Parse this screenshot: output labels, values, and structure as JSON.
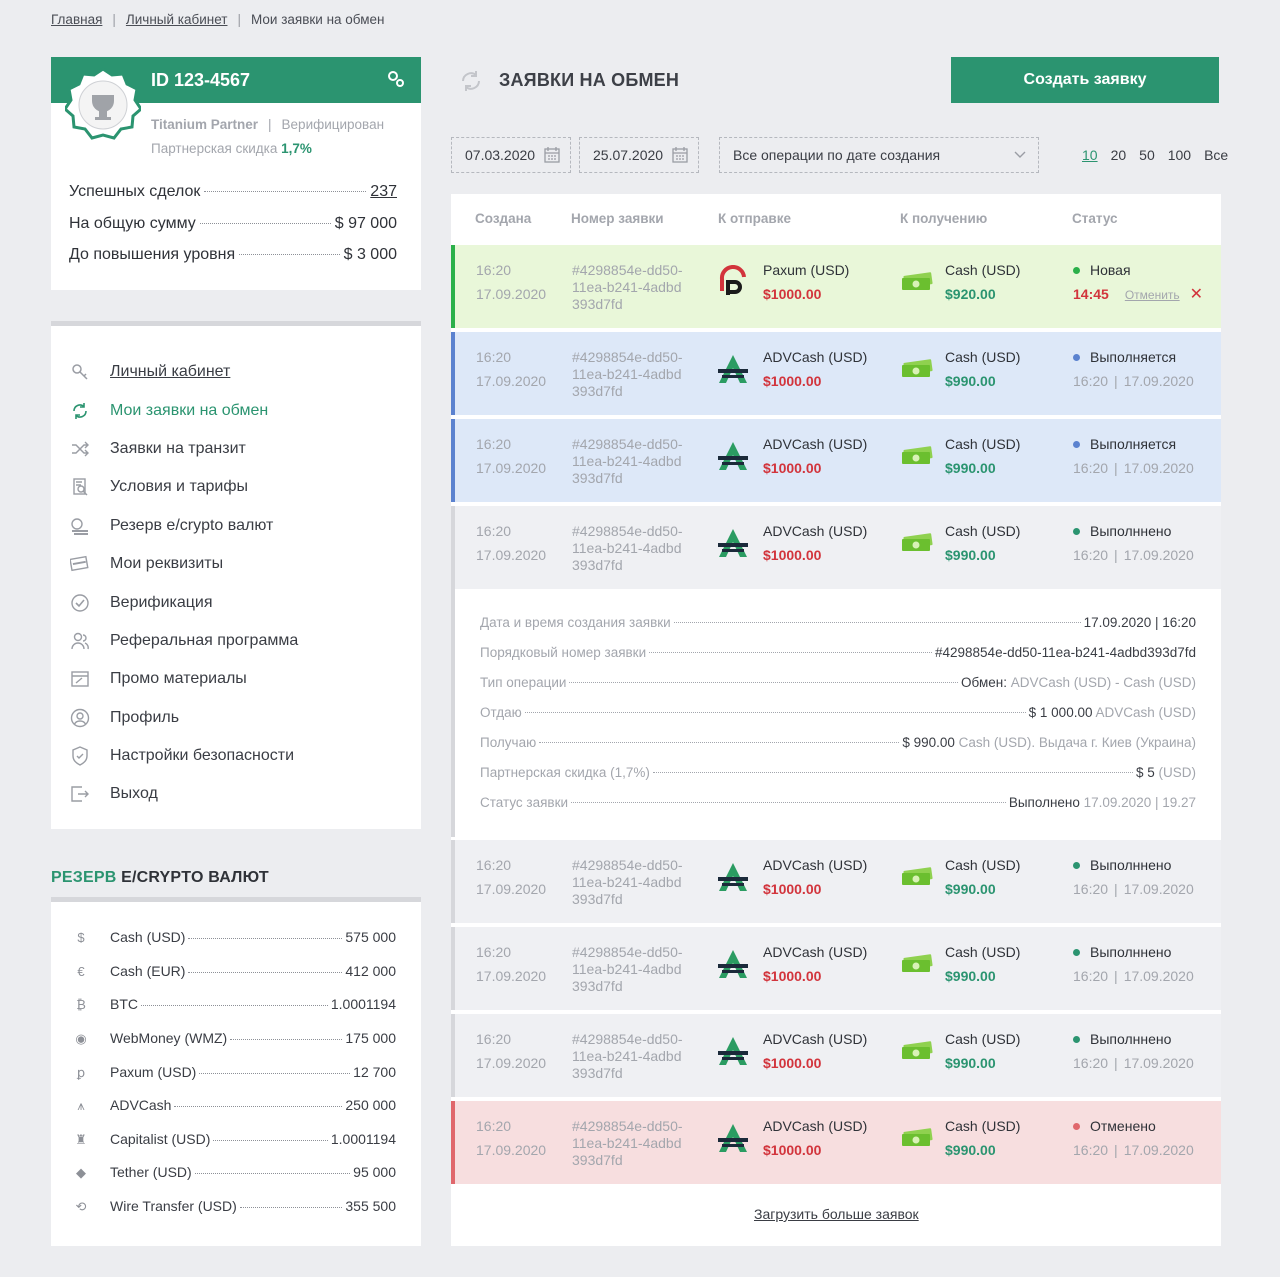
{
  "breadcrumb": {
    "items": [
      "Главная",
      "Личный кабинет",
      "Мои заявки на обмен"
    ]
  },
  "account": {
    "id": "ID 123-4567",
    "level": "Titanium Partner",
    "verified": "Верифицирован",
    "discount_label": "Партнерская скидка",
    "discount_value": "1,7%",
    "stats": [
      {
        "label": "Успешных сделок",
        "value": "237"
      },
      {
        "label": "На общую сумму",
        "value": "$ 97 000"
      },
      {
        "label": "До повышения уровня",
        "value": "$ 3 000"
      }
    ]
  },
  "sidebar": {
    "items": [
      {
        "label": "Личный кабинет",
        "icon": "key-icon"
      },
      {
        "label": "Мои заявки на обмен",
        "icon": "refresh-icon"
      },
      {
        "label": "Заявки на транзит",
        "icon": "shuffle-icon"
      },
      {
        "label": "Условия и тарифы",
        "icon": "document-search-icon"
      },
      {
        "label": "Резерв e/crypto валют",
        "icon": "coins-icon"
      },
      {
        "label": "Мои реквизиты",
        "icon": "card-icon"
      },
      {
        "label": "Верификация",
        "icon": "check-circle-icon"
      },
      {
        "label": "Реферальная программа",
        "icon": "users-icon"
      },
      {
        "label": "Промо материалы",
        "icon": "promo-icon"
      },
      {
        "label": "Профиль",
        "icon": "user-circle-icon"
      },
      {
        "label": "Настройки безопасности",
        "icon": "shield-icon"
      },
      {
        "label": "Выход",
        "icon": "logout-icon"
      }
    ]
  },
  "reserve": {
    "title_green": "РЕЗЕРВ",
    "title_rest": "E/CRYPTO ВАЛЮТ",
    "items": [
      {
        "name": "Cash (USD)",
        "value": "575 000",
        "icon": "$"
      },
      {
        "name": "Cash (EUR)",
        "value": "412 000",
        "icon": "€"
      },
      {
        "name": "BTC",
        "value": "1.0001194",
        "icon": "₿"
      },
      {
        "name": "WebMoney (WMZ)",
        "value": "175 000",
        "icon": "◉"
      },
      {
        "name": "Paxum (USD)",
        "value": "12 700",
        "icon": "ꝑ"
      },
      {
        "name": "ADVCash",
        "value": "250 000",
        "icon": "⩚"
      },
      {
        "name": "Capitalist (USD)",
        "value": "1.0001194",
        "icon": "♜"
      },
      {
        "name": "Tether (USD)",
        "value": "95 000",
        "icon": "◆"
      },
      {
        "name": "Wire Transfer (USD)",
        "value": "355 500",
        "icon": "⟲"
      }
    ]
  },
  "main": {
    "title": "ЗАЯВКИ НА ОБМЕН",
    "create_button": "Создать заявку",
    "date_from": "07.03.2020",
    "date_to": "25.07.2020",
    "filter": "Все операции по дате создания",
    "per_page": [
      "10",
      "20",
      "50",
      "100",
      "Все"
    ],
    "columns": [
      "Создана",
      "Номер заявки",
      "К отправке",
      "К получению",
      "Статус"
    ],
    "load_more": "Загрузить больше заявок"
  },
  "orders": [
    {
      "time": "16:20",
      "date": "17.09.2020",
      "id1": "#4298854e-dd50-",
      "id2": "11ea-b241-4adbd",
      "id3": "393d7fd",
      "send_name": "Paxum (USD)",
      "send_amount": "$1000.00",
      "recv_name": "Cash (USD)",
      "recv_amount": "$920.00",
      "status": "Новая",
      "status_time": "14:45",
      "cancel": "Отменить",
      "kind": "new"
    },
    {
      "time": "16:20",
      "date": "17.09.2020",
      "id1": "#4298854e-dd50-",
      "id2": "11ea-b241-4adbd",
      "id3": "393d7fd",
      "send_name": "ADVCash (USD)",
      "send_amount": "$1000.00",
      "recv_name": "Cash (USD)",
      "recv_amount": "$990.00",
      "status": "Выполняется",
      "status_time": "16:20",
      "status_date": "17.09.2020",
      "kind": "progress"
    },
    {
      "time": "16:20",
      "date": "17.09.2020",
      "id1": "#4298854e-dd50-",
      "id2": "11ea-b241-4adbd",
      "id3": "393d7fd",
      "send_name": "ADVCash (USD)",
      "send_amount": "$1000.00",
      "recv_name": "Cash (USD)",
      "recv_amount": "$990.00",
      "status": "Выполняется",
      "status_time": "16:20",
      "status_date": "17.09.2020",
      "kind": "progress"
    },
    {
      "time": "16:20",
      "date": "17.09.2020",
      "id1": "#4298854e-dd50-",
      "id2": "11ea-b241-4adbd",
      "id3": "393d7fd",
      "send_name": "ADVCash (USD)",
      "send_amount": "$1000.00",
      "recv_name": "Cash (USD)",
      "recv_amount": "$990.00",
      "status": "Выполннено",
      "status_time": "16:20",
      "status_date": "17.09.2020",
      "kind": "done"
    },
    {
      "time": "16:20",
      "date": "17.09.2020",
      "id1": "#4298854e-dd50-",
      "id2": "11ea-b241-4adbd",
      "id3": "393d7fd",
      "send_name": "ADVCash (USD)",
      "send_amount": "$1000.00",
      "recv_name": "Cash (USD)",
      "recv_amount": "$990.00",
      "status": "Выполннено",
      "status_time": "16:20",
      "status_date": "17.09.2020",
      "kind": "done"
    },
    {
      "time": "16:20",
      "date": "17.09.2020",
      "id1": "#4298854e-dd50-",
      "id2": "11ea-b241-4adbd",
      "id3": "393d7fd",
      "send_name": "ADVCash (USD)",
      "send_amount": "$1000.00",
      "recv_name": "Cash (USD)",
      "recv_amount": "$990.00",
      "status": "Выполннено",
      "status_time": "16:20",
      "status_date": "17.09.2020",
      "kind": "done"
    },
    {
      "time": "16:20",
      "date": "17.09.2020",
      "id1": "#4298854e-dd50-",
      "id2": "11ea-b241-4adbd",
      "id3": "393d7fd",
      "send_name": "ADVCash (USD)",
      "send_amount": "$1000.00",
      "recv_name": "Cash (USD)",
      "recv_amount": "$990.00",
      "status": "Выполннено",
      "status_time": "16:20",
      "status_date": "17.09.2020",
      "kind": "done"
    },
    {
      "time": "16:20",
      "date": "17.09.2020",
      "id1": "#4298854e-dd50-",
      "id2": "11ea-b241-4adbd",
      "id3": "393d7fd",
      "send_name": "ADVCash (USD)",
      "send_amount": "$1000.00",
      "recv_name": "Cash (USD)",
      "recv_amount": "$990.00",
      "status": "Отменено",
      "status_time": "16:20",
      "status_date": "17.09.2020",
      "kind": "cancelled"
    }
  ],
  "details": {
    "rows": [
      {
        "label": "Дата и время создания заявки",
        "value": "17.09.2020  |  16:20",
        "extra": ""
      },
      {
        "label": "Порядковый номер заявки",
        "value": "#4298854e-dd50-11ea-b241-4adbd393d7fd",
        "extra": ""
      },
      {
        "label": "Тип операции",
        "value": "Обмен:",
        "extra": " ADVCash (USD) - Cash (USD)"
      },
      {
        "label": "Отдаю",
        "value": "$ 1 000.00",
        "extra": " ADVCash (USD)"
      },
      {
        "label": "Получаю",
        "value": "$ 990.00",
        "extra": " Cash (USD). Выдача г. Киев (Украина)"
      },
      {
        "label": "Партнерская скидка (1,7%)",
        "value": "$ 5",
        "extra": " (USD)"
      },
      {
        "label": "Статус заявки",
        "value": "Выполнено",
        "extra": " 17.09.2020  |  19.27"
      }
    ]
  },
  "colors": {
    "accent": "#2b9470",
    "new_bg": "#e9f7d9",
    "new_bar": "#2bb04a",
    "progress_bg": "#dde8f8",
    "progress_bar": "#5b82cf",
    "progress_dot": "#5b82cf",
    "done_bg": "#eff0f3",
    "done_bar": "#d6d7db",
    "cancel_bg": "#f7dedf",
    "cancel_bar": "#e0676c",
    "cancel_dot": "#e0676c"
  }
}
